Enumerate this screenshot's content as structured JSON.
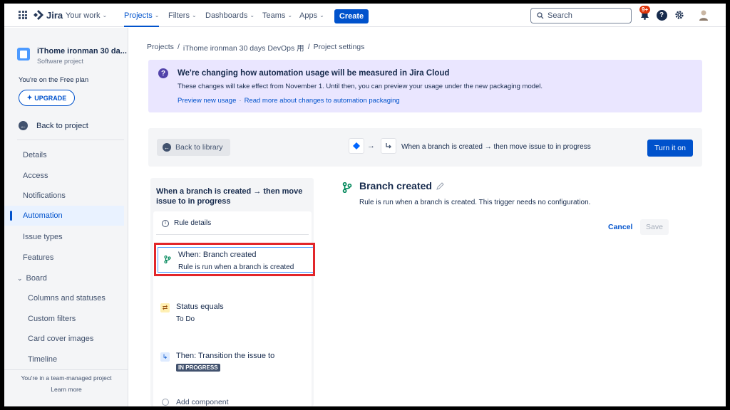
{
  "topbar": {
    "logo_text": "Jira",
    "nav": [
      {
        "label": "Your work"
      },
      {
        "label": "Projects"
      },
      {
        "label": "Filters"
      },
      {
        "label": "Dashboards"
      },
      {
        "label": "Teams"
      },
      {
        "label": "Apps"
      }
    ],
    "create_label": "Create",
    "search_placeholder": "Search",
    "notification_badge": "9+"
  },
  "sidebar": {
    "project_name": "iThome ironman 30 da...",
    "project_type": "Software project",
    "plan_text": "You're on the Free plan",
    "upgrade_label": "UPGRADE",
    "back_label": "Back to project",
    "items": [
      {
        "label": "Details"
      },
      {
        "label": "Access"
      },
      {
        "label": "Notifications"
      },
      {
        "label": "Automation"
      },
      {
        "label": "Issue types"
      },
      {
        "label": "Features"
      },
      {
        "label": "Board"
      },
      {
        "label": "Columns and statuses"
      },
      {
        "label": "Custom filters"
      },
      {
        "label": "Card cover images"
      },
      {
        "label": "Timeline"
      }
    ],
    "team_text": "You're in a team-managed project",
    "learn_more": "Learn more"
  },
  "breadcrumb": [
    "Projects",
    "/",
    "iThome ironman 30 days DevOps 用",
    "/",
    "Project settings"
  ],
  "banner": {
    "title": "We're changing how automation usage will be measured in Jira Cloud",
    "body": "These changes will take effect from November 1. Until then, you can preview your usage under the new packaging model.",
    "link1": "Preview new usage",
    "separator": "·",
    "link2": "Read more about changes to automation packaging"
  },
  "rule_bar": {
    "back_label": "Back to library",
    "flow_label": "When a branch is created → then move issue to in progress",
    "turn_on_label": "Turn it on"
  },
  "rule_panel": {
    "title": "When a branch is created → then move issue to in progress",
    "details_label": "Rule details",
    "steps": [
      {
        "title": "When: Branch created",
        "sub": "Rule is run when a branch is created"
      },
      {
        "title": "Status equals",
        "sub": "To Do"
      },
      {
        "title": "Then: Transition the issue to",
        "lozenge": "IN PROGRESS"
      }
    ],
    "add_component": "Add component"
  },
  "detail": {
    "title": "Branch created",
    "description": "Rule is run when a branch is created. This trigger needs no configuration.",
    "cancel_label": "Cancel",
    "save_label": "Save"
  },
  "colors": {
    "accent": "#0052CC",
    "banner_bg": "#EAE6FF",
    "highlight": "#E2262A"
  }
}
